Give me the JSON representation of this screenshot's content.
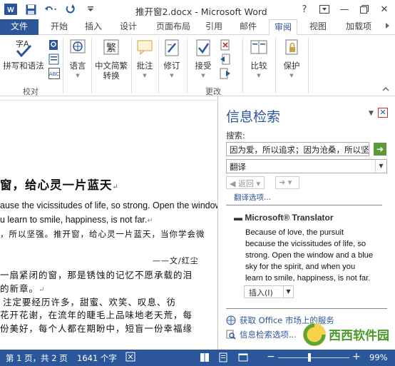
{
  "window": {
    "title": "推开窗2.docx - Microsoft Word",
    "help": "?",
    "minimize": "—",
    "close": "✕"
  },
  "tabs": [
    {
      "label": "文件"
    },
    {
      "label": "开始"
    },
    {
      "label": "插入"
    },
    {
      "label": "设计"
    },
    {
      "label": "页面布局"
    },
    {
      "label": "引用"
    },
    {
      "label": "邮件"
    },
    {
      "label": "审阅"
    },
    {
      "label": "视图"
    },
    {
      "label": "加载项"
    }
  ],
  "ribbon": {
    "proofing": {
      "spelling": "拼写和语法",
      "group": "校对"
    },
    "language": "语言",
    "convert": {
      "line1": "中文简繁",
      "line2": "转换"
    },
    "comment": "批注",
    "track": "修订",
    "changes": {
      "accept": "接受",
      "group": "更改"
    },
    "compare": "比较",
    "protect": "保护"
  },
  "document": {
    "line_en1": "ause the vicissitudes of life, so strong. Open the window",
    "line_en2": "u learn to smile, happiness, is not far.",
    "line_cn0": "，所以坚强。推开窗，给心灵一片蓝天，当你学会微",
    "heading": "窗，给心灵一片蓝天",
    "author": "——文/红尘",
    "p1": "一扇紧闭的窗，那是锈蚀的记忆不愿承载的泪",
    "p2": "的新章。",
    "p3": "注定要经历许多，甜蜜、欢笑、叹息、彷",
    "p4": "花开花谢，在流年的睫毛上品味地老天荒，每",
    "p5": "份美好，每个人都在期盼中，短盲一份幸福缘"
  },
  "research_pane": {
    "title": "信息检索",
    "search_label": "搜索:",
    "search_value": "因为爱，所以追求；因为沧桑，所以坚",
    "service": "翻译",
    "back": "返回",
    "options_link": "翻译选项...",
    "result_header": "Microsoft® Translator",
    "result_text": "Because of love, the pursuit because the vicissitudes of life, so strong. Open the window and a blue sky for the spirit, and when you learn to smile, happiness, is not far.",
    "insert": "插入(I)",
    "link_office": "获取 Office 市场上的服务",
    "link_options": "信息检索选项..."
  },
  "status_bar": {
    "page": "第 1 页，共 2 页",
    "words": "1641 个字",
    "zoom": "99%"
  },
  "watermark": {
    "text": "西西软件园"
  },
  "colors": {
    "accent": "#2b579a",
    "go": "#5b9a3a"
  }
}
